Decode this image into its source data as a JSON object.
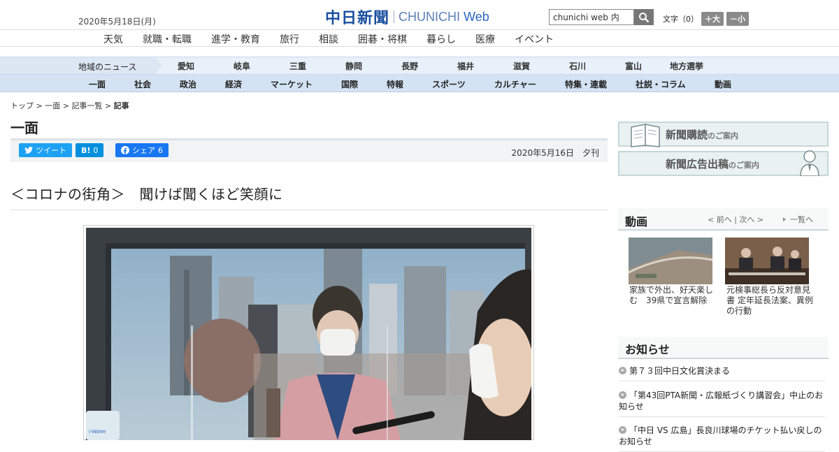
{
  "header": {
    "date": "2020年5月18日(月)",
    "logo_jp": "中日新聞",
    "logo_en_1": "CHUNICHI",
    "logo_en_2": "Web",
    "search_value": "chunichi web 内",
    "font_label": "文字（0）",
    "font_larger": "＋大",
    "font_smaller": "－小"
  },
  "nav_primary": [
    "天気",
    "就職・転職",
    "進学・教育",
    "旅行",
    "相談",
    "囲碁・将棋",
    "暮らし",
    "医療",
    "イベント"
  ],
  "nav_regional": {
    "label": "地域のニュース",
    "items": [
      "愛知",
      "岐阜",
      "三重",
      "静岡",
      "長野",
      "福井",
      "滋賀",
      "石川",
      "富山",
      "地方選挙"
    ]
  },
  "nav_sections": [
    "一面",
    "社会",
    "政治",
    "経済",
    "マーケット",
    "国際",
    "特報",
    "スポーツ",
    "カルチャー",
    "特集・連載",
    "社説・コラム",
    "動画"
  ],
  "breadcrumb": {
    "items": [
      "トップ",
      "一面",
      "記事一覧"
    ],
    "current": "記事",
    "sep": " > "
  },
  "section_title": "一面",
  "share": {
    "tweet": "ツイート",
    "hatena": "B!",
    "hatena_count": "0",
    "facebook": "シェア",
    "facebook_count": "6"
  },
  "article": {
    "pub_date": "2020年5月16日　夕刊",
    "title": "＜コロナの街角＞　聞けば聞くほど笑顔に",
    "photo_bottle_text": "i-Water"
  },
  "sidebar": {
    "banner_subscribe": {
      "main": "新聞購読",
      "sub": "のご案内"
    },
    "banner_ads": {
      "main": "新聞広告出稿",
      "sub": "のご案内"
    },
    "video": {
      "heading": "動画",
      "prev": "前へ",
      "next": "次へ",
      "list": "一覧へ",
      "items": [
        {
          "caption": "家族で外出、好天楽しむ　39県で宣言解除"
        },
        {
          "caption": "元検事総長ら反対意見書 定年延長法案、異例の行動"
        }
      ]
    },
    "notices": {
      "heading": "お知らせ",
      "items": [
        "第７３回中日文化賞決まる",
        "「第43回PTA新聞・広報紙づくり講習会」中止のお知らせ",
        "「中日 VS 広島」長良川球場のチケット払い戻しのお知らせ"
      ]
    }
  },
  "colors": {
    "brand": "#1a4fa0",
    "twitter": "#1da1f2",
    "hatena": "#008fde",
    "facebook": "#1877f2",
    "nav_bg": "#d4e3f3"
  }
}
